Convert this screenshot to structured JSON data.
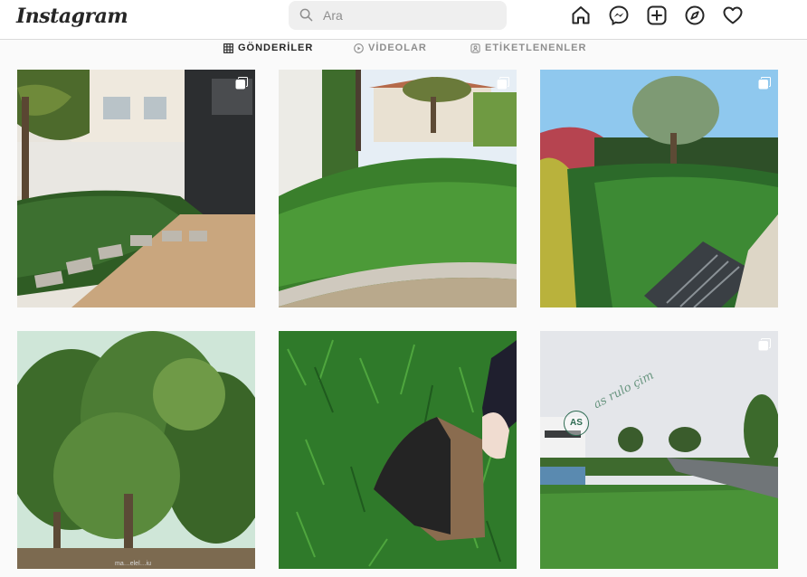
{
  "app": {
    "logo": "Instagram"
  },
  "search": {
    "placeholder": "Ara",
    "value": ""
  },
  "nav": {
    "icons": [
      "home-icon",
      "messenger-icon",
      "new-post-icon",
      "explore-icon",
      "activity-heart-icon"
    ]
  },
  "tabs": [
    {
      "label": "GÖNDERİLER",
      "icon": "grid-icon",
      "active": true
    },
    {
      "label": "VİDEOLAR",
      "icon": "play-icon",
      "active": false
    },
    {
      "label": "ETİKETLENENLER",
      "icon": "tag-icon",
      "active": false
    }
  ],
  "posts": [
    {
      "subject": "artificial lawn with stepping stones beside dark house and wooden deck",
      "multiple": true
    },
    {
      "subject": "large green lawn garden with olive tree and stone curb",
      "multiple": true
    },
    {
      "subject": "lawn with olive tree, red hedge and drain grate",
      "multiple": true
    },
    {
      "subject": "fig trees in orchard",
      "multiple": false,
      "caption": "ma…elel…iu"
    },
    {
      "subject": "hand lifting a piece of turf showing soil",
      "multiple": false
    },
    {
      "subject": "new rolled lawn beside modern house",
      "multiple": true,
      "watermark": "as rulo çim",
      "logo_text": "AS"
    }
  ],
  "colors": {
    "text_primary": "#262626",
    "text_secondary": "#8e8e8e",
    "background": "#fafafa",
    "border": "#dbdbdb"
  }
}
